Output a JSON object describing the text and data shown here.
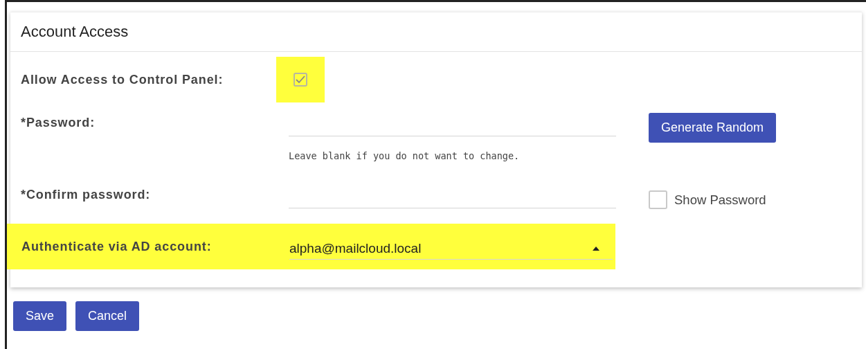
{
  "panel": {
    "title": "Account Access"
  },
  "fields": [
    {
      "kind": "checkbox",
      "label": "Allow Access to Control Panel:",
      "checked": true,
      "highlighted": true
    },
    {
      "kind": "password",
      "label": "*Password:",
      "hint": "Leave blank if you do not want to change.",
      "side": {
        "kind": "button",
        "label": "Generate Random"
      }
    },
    {
      "kind": "password",
      "label": "*Confirm password:",
      "side": {
        "kind": "checkbox",
        "label": "Show Password",
        "checked": false
      }
    },
    {
      "kind": "select",
      "label": "Authenticate via AD account:",
      "value": "alpha@mailcloud.local",
      "expanded": true,
      "highlighted": true
    }
  ],
  "buttons": [
    "Save",
    "Cancel"
  ]
}
